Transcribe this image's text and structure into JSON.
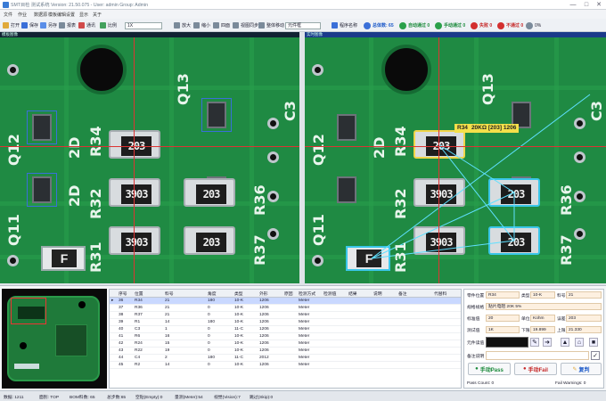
{
  "window": {
    "title": "SMT目检 测试系统 Version: 21.50.075 - User: admin  Group: Admin",
    "minimize": "—",
    "maximize": "□",
    "close": "✕"
  },
  "menu": [
    "文件",
    "作业",
    "数据源",
    "模板编辑",
    "设置",
    "显示",
    "关于"
  ],
  "toolbar": {
    "items": [
      "打开",
      "保存",
      "另存",
      "报表",
      "通讯",
      "比例"
    ],
    "zoom_value": "1X",
    "mid_items": [
      "放大",
      "缩小",
      "四面",
      "视图同步",
      "整体移动"
    ],
    "dropdown_value": "元件框",
    "program_label": "程序名称",
    "total": "总体数: 65",
    "auto": "自动通过 0",
    "manual": "手动通过 0",
    "fail_mark": "失败 0",
    "pause": "不通过 0",
    "progress": "0%"
  },
  "left_pane": {
    "header": "模板图像"
  },
  "right_pane": {
    "header": "实时图像",
    "tooltip": {
      "ref": "R34",
      "text": "20KΩ [203] 1206"
    }
  },
  "pcb": {
    "chip_code_a": "203",
    "chip_code_b": "3903",
    "f_code": "F",
    "labels": [
      "Q12",
      "2D",
      "R34",
      "Q13",
      "C3",
      "Q11",
      "2D",
      "R32",
      "R31",
      "R37",
      "R36",
      "2D",
      "R38"
    ]
  },
  "grid": {
    "headers": [
      "序号",
      "位置",
      "料号",
      "角度",
      "类型",
      "外形",
      "原因",
      "检测方式",
      "检测值",
      "结果",
      "说明",
      "备注",
      "代替料"
    ],
    "rows": [
      [
        "36",
        "R34",
        "21",
        "180",
        "10-K",
        "1206",
        "",
        "Meter"
      ],
      [
        "37",
        "R36",
        "21",
        "0",
        "10-K",
        "1206",
        "",
        "Meter"
      ],
      [
        "38",
        "R37",
        "21",
        "0",
        "10-K",
        "1206",
        "",
        "Meter"
      ],
      [
        "39",
        "R1",
        "14",
        "180",
        "10-K",
        "1206",
        "",
        "Meter"
      ],
      [
        "40",
        "C3",
        "1",
        "0",
        "11-C",
        "1206",
        "",
        "Meter"
      ],
      [
        "41",
        "R6",
        "16",
        "0",
        "10-K",
        "1206",
        "",
        "Meter"
      ],
      [
        "42",
        "R24",
        "15",
        "0",
        "10-K",
        "1206",
        "",
        "Meter"
      ],
      [
        "43",
        "R22",
        "19",
        "0",
        "10-K",
        "1206",
        "",
        "Meter"
      ],
      [
        "44",
        "C4",
        "2",
        "180",
        "11-C",
        "2012",
        "",
        "Meter"
      ],
      [
        "45",
        "R2",
        "14",
        "0",
        "10-K",
        "1206",
        "",
        "Meter"
      ]
    ]
  },
  "info": {
    "pos_label": "零件位置",
    "pos_value": "R34",
    "type_label": "类型",
    "type_value": "10-K",
    "pn_label": "料号",
    "pn_value": "21",
    "spec_label": "规格规格",
    "spec_value": "贴片电阻 20K 5%",
    "nominal_label": "标准值",
    "nominal_value": "20",
    "unit_label": "单位",
    "unit_value": "Kohm",
    "tol_label": "误差",
    "tol_value": "203",
    "measure_label": "测试值",
    "measure_value": "1K",
    "low_label": "下限",
    "low_value": "19.899",
    "high_label": "上限",
    "high_value": "21.330",
    "disp_label": "元件读值",
    "note_label": "备注说明",
    "pass_label": "手动Pass",
    "fail_label": "手动Fail",
    "redo_label": "复判",
    "pass_count": "Pass Count: 0",
    "fail_warnings": "Fail Warnings: 0"
  },
  "status": [
    "数据: 1211",
    "面别: TOP",
    "BOM料数: 65",
    "总步数:65",
    "空贴(Empty):0",
    "量测(Meter):54",
    "视觉(Vision):7",
    "跳过(Skip):0"
  ],
  "colors": {
    "pcb": "#1f8a43",
    "accent": "#3a6fd8",
    "selected_row": "#c9d8ff",
    "tooltip": "#f4e04a"
  }
}
